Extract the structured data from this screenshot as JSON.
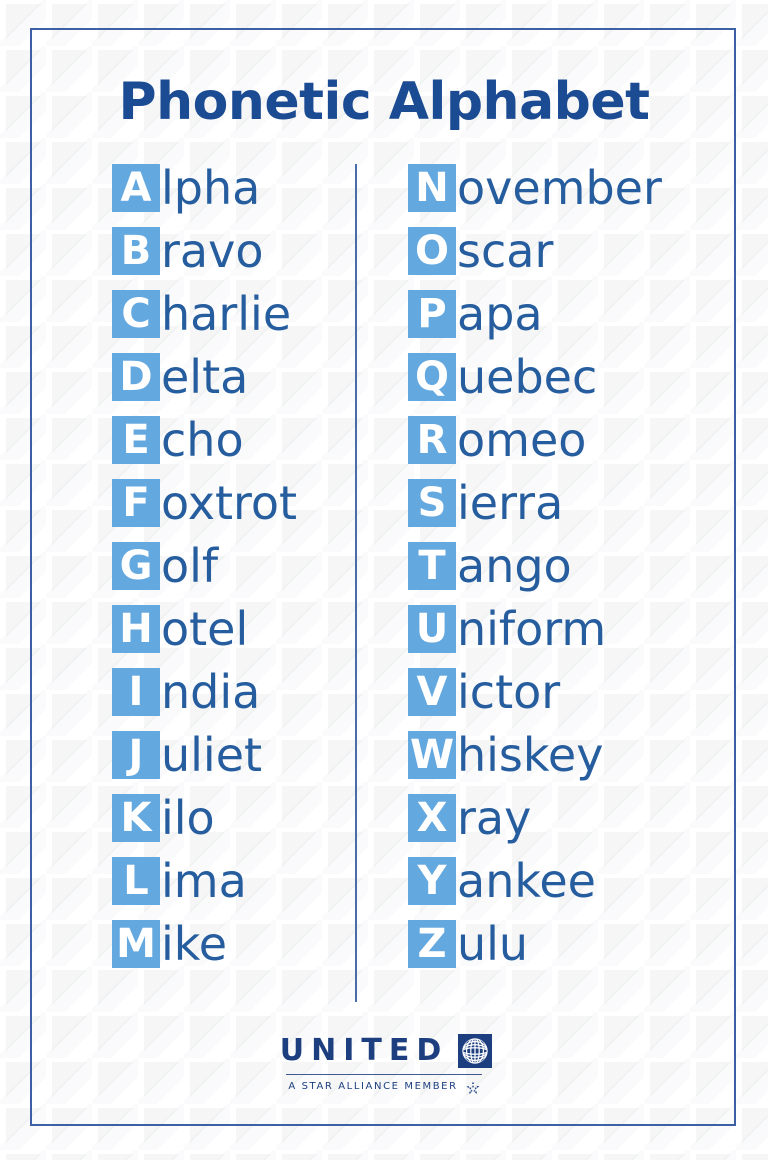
{
  "poster": {
    "title": "Phonetic Alphabet",
    "colors": {
      "title_blue": "#1b4b92",
      "badge_blue": "#64a8e0",
      "word_blue": "#265d9e",
      "border_blue": "#3d5fa6",
      "divider_blue": "#4a6ca8",
      "logo_blue": "#1d3f80",
      "background": "#fdfdfd",
      "badge_letter": "#ffffff"
    }
  },
  "columns": {
    "left": [
      {
        "letter": "A",
        "rest": "lpha",
        "word": "Alpha"
      },
      {
        "letter": "B",
        "rest": "ravo",
        "word": "Bravo"
      },
      {
        "letter": "C",
        "rest": "harlie",
        "word": "Charlie"
      },
      {
        "letter": "D",
        "rest": "elta",
        "word": "Delta"
      },
      {
        "letter": "E",
        "rest": "cho",
        "word": "Echo"
      },
      {
        "letter": "F",
        "rest": "oxtrot",
        "word": "Foxtrot"
      },
      {
        "letter": "G",
        "rest": "olf",
        "word": "Golf"
      },
      {
        "letter": "H",
        "rest": "otel",
        "word": "Hotel"
      },
      {
        "letter": "I",
        "rest": "ndia",
        "word": "India"
      },
      {
        "letter": "J",
        "rest": "uliet",
        "word": "Juliet"
      },
      {
        "letter": "K",
        "rest": "ilo",
        "word": "Kilo"
      },
      {
        "letter": "L",
        "rest": "ima",
        "word": "Lima"
      },
      {
        "letter": "M",
        "rest": "ike",
        "word": "Mike"
      }
    ],
    "right": [
      {
        "letter": "N",
        "rest": "ovember",
        "word": "November"
      },
      {
        "letter": "O",
        "rest": "scar",
        "word": "Oscar"
      },
      {
        "letter": "P",
        "rest": "apa",
        "word": "Papa"
      },
      {
        "letter": "Q",
        "rest": "uebec",
        "word": "Quebec"
      },
      {
        "letter": "R",
        "rest": "omeo",
        "word": "Romeo"
      },
      {
        "letter": "S",
        "rest": "ierra",
        "word": "Sierra"
      },
      {
        "letter": "T",
        "rest": "ango",
        "word": "Tango"
      },
      {
        "letter": "U",
        "rest": "niform",
        "word": "Uniform"
      },
      {
        "letter": "V",
        "rest": "ictor",
        "word": "Victor"
      },
      {
        "letter": "W",
        "rest": "hiskey",
        "word": "Whiskey"
      },
      {
        "letter": "X",
        "rest": "ray",
        "word": "Xray"
      },
      {
        "letter": "Y",
        "rest": "ankee",
        "word": "Yankee"
      },
      {
        "letter": "Z",
        "rest": "ulu",
        "word": "Zulu"
      }
    ]
  },
  "logo": {
    "wordmark": "UNITED",
    "tagline": "A STAR ALLIANCE MEMBER",
    "globe_icon": "united-globe-icon",
    "star_icon": "star-alliance-icon"
  }
}
